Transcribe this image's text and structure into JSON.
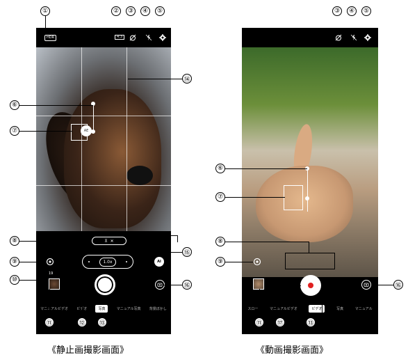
{
  "still_screen": {
    "caption": "《静止画撮影画面》",
    "hdr_label": "HDR",
    "ratio_label": "4:3",
    "zoom_value": "1.0x",
    "ai_label": "AI",
    "ae_label": "AE",
    "count_label": "19",
    "modes": [
      "マニュアルビデオ",
      "ビデオ",
      "写真",
      "マニュアル写真",
      "背景ぼかし"
    ],
    "active_mode": "写真"
  },
  "video_screen": {
    "caption": "《動画撮影画面》",
    "modes": [
      "スロー",
      "マニュアルビデオ",
      "ビデオ",
      "写真",
      "マニュアル"
    ],
    "active_mode": "ビデオ"
  },
  "callouts": {
    "c1": "①",
    "c2": "②",
    "c3": "③",
    "c4": "④",
    "c5": "⑤",
    "c6": "⑥",
    "c7": "⑦",
    "c8": "⑧",
    "c9": "⑨",
    "c10": "⑩",
    "c11": "⑪",
    "c12": "⑫",
    "c13": "⑬",
    "c14": "⑭",
    "c15": "⑮",
    "c16": "⑯",
    "c17": "⑰"
  },
  "icons": {
    "timer": "timer-off-icon",
    "flash": "flash-off-icon",
    "settings": "gear-icon",
    "lens": "lens-icon",
    "switch": "camera-switch-icon"
  }
}
